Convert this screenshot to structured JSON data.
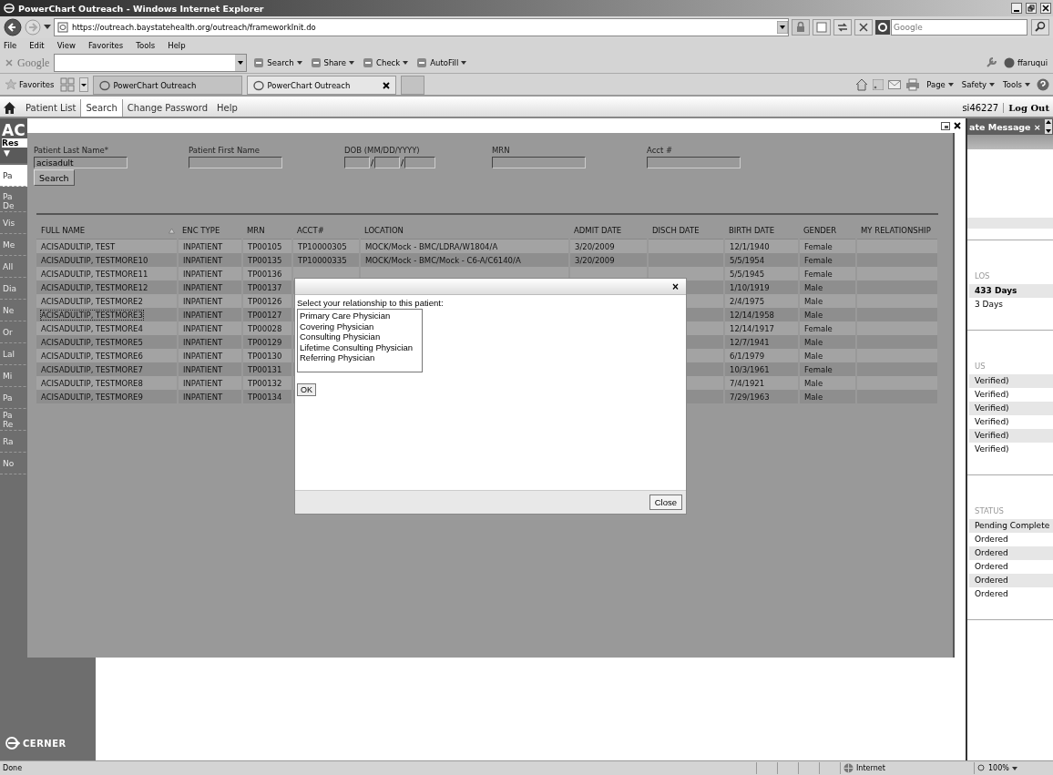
{
  "browser": {
    "title": "PowerChart Outreach - Windows Internet Explorer",
    "url": "https://outreach.baystatehealth.org/outreach/frameworkInit.do",
    "search_placeholder": "Google",
    "menu": [
      "File",
      "Edit",
      "View",
      "Favorites",
      "Tools",
      "Help"
    ],
    "google_toolbar": {
      "logo": "Google",
      "buttons": [
        "Search",
        "Share",
        "Check",
        "AutoFill"
      ],
      "user": "ffaruqui"
    },
    "favorites": "Favorites",
    "tabs": [
      {
        "label": "PowerChart Outreach",
        "selected": false
      },
      {
        "label": "PowerChart Outreach",
        "selected": true
      }
    ],
    "command_bar": [
      "Page",
      "Safety",
      "Tools"
    ],
    "status": "Done",
    "zone": "Internet",
    "zoom": "100%"
  },
  "app_nav": {
    "items": [
      {
        "label": "Patient List",
        "selected": false
      },
      {
        "label": "Search",
        "selected": true
      },
      {
        "label": "Change Password",
        "selected": false
      },
      {
        "label": "Help",
        "selected": false
      }
    ],
    "user": "si46227",
    "logout": "Log Out"
  },
  "sidebar": {
    "title": "AC",
    "subtitle": "Res",
    "toggle": "▼",
    "items": [
      {
        "label": "Pa",
        "selected": true
      },
      {
        "label": "Pa De",
        "selected": false
      },
      {
        "label": "Vis",
        "selected": false
      },
      {
        "label": "Me",
        "selected": false
      },
      {
        "label": "All",
        "selected": false
      },
      {
        "label": "Dia",
        "selected": false
      },
      {
        "label": "Ne",
        "selected": false
      },
      {
        "label": "Or",
        "selected": false
      },
      {
        "label": "Lal",
        "selected": false
      },
      {
        "label": "Mi",
        "selected": false
      },
      {
        "label": "Pa",
        "selected": false
      },
      {
        "label": "Pa Re",
        "selected": false
      },
      {
        "label": "Ra",
        "selected": false
      },
      {
        "label": "No",
        "selected": false
      }
    ],
    "logo": "CERNER"
  },
  "right_panel": {
    "tab": "ate Message ×",
    "sections": [
      {
        "header": "LOS",
        "rows": [
          {
            "text": "433 Days",
            "bold": true
          },
          {
            "text": "3 Days",
            "bold": false
          }
        ]
      },
      {
        "header": "US",
        "rows": [
          {
            "text": "Verified)",
            "bold": false
          },
          {
            "text": "Verified)",
            "bold": false
          },
          {
            "text": "Verified)",
            "bold": false
          },
          {
            "text": "Verified)",
            "bold": false
          },
          {
            "text": "Verified)",
            "bold": false
          },
          {
            "text": "Verified)",
            "bold": false
          }
        ]
      },
      {
        "header": "STATUS",
        "rows": [
          {
            "text": "Pending Complete",
            "bold": false
          },
          {
            "text": "Ordered",
            "bold": false
          },
          {
            "text": "Ordered",
            "bold": false
          },
          {
            "text": "Ordered",
            "bold": false
          },
          {
            "text": "Ordered",
            "bold": false
          },
          {
            "text": "Ordered",
            "bold": false
          }
        ]
      }
    ]
  },
  "search": {
    "fields": [
      {
        "kind": "text",
        "label": "Patient Last Name*",
        "value": "acisadult"
      },
      {
        "kind": "text",
        "label": "Patient First Name"
      },
      {
        "kind": "date",
        "label": "DOB (MM/DD/YYYY)",
        "separator": "/"
      },
      {
        "kind": "text",
        "label": "MRN"
      },
      {
        "kind": "text",
        "label": "Acct #"
      }
    ],
    "search_button": "Search",
    "table": {
      "columns": [
        {
          "label": "FULL NAME",
          "sorted": true
        },
        {
          "label": "ENC TYPE",
          "sorted": false
        },
        {
          "label": "MRN",
          "sorted": false
        },
        {
          "label": "ACCT#",
          "sorted": false
        },
        {
          "label": "LOCATION",
          "sorted": false
        },
        {
          "label": "ADMIT DATE",
          "sorted": false
        },
        {
          "label": "DISCH DATE",
          "sorted": false
        },
        {
          "label": "BIRTH DATE",
          "sorted": false
        },
        {
          "label": "GENDER",
          "sorted": false
        },
        {
          "label": "MY RELATIONSHIP",
          "sorted": false
        }
      ],
      "rows": [
        {
          "full_name": "ACISADULTIP, TEST",
          "enc_type": "INPATIENT",
          "mrn": "TP00105",
          "acct": "TP10000305",
          "location": "MOCK/Mock - BMC/LDRA/W1804/A",
          "admit_date": "3/20/2009",
          "birth_date": "12/1/1940",
          "gender": "Female",
          "focused": false
        },
        {
          "full_name": "ACISADULTIP, TESTMORE10",
          "enc_type": "INPATIENT",
          "mrn": "TP00135",
          "acct": "TP10000335",
          "location": "MOCK/Mock - BMC/Mock - C6-A/C6140/A",
          "admit_date": "3/20/2009",
          "birth_date": "5/5/1954",
          "gender": "Female",
          "focused": false
        },
        {
          "full_name": "ACISADULTIP, TESTMORE11",
          "enc_type": "INPATIENT",
          "mrn": "TP00136",
          "birth_date": "5/5/1945",
          "gender": "Female",
          "focused": false
        },
        {
          "full_name": "ACISADULTIP, TESTMORE12",
          "enc_type": "INPATIENT",
          "mrn": "TP00137",
          "birth_date": "1/10/1919",
          "gender": "Male",
          "focused": false
        },
        {
          "full_name": "ACISADULTIP, TESTMORE2",
          "enc_type": "INPATIENT",
          "mrn": "TP00126",
          "birth_date": "2/4/1975",
          "gender": "Male",
          "focused": false
        },
        {
          "full_name": "ACISADULTIP, TESTMORE3",
          "enc_type": "INPATIENT",
          "mrn": "TP00127",
          "birth_date": "12/14/1958",
          "gender": "Male",
          "focused": true
        },
        {
          "full_name": "ACISADULTIP, TESTMORE4",
          "enc_type": "INPATIENT",
          "mrn": "TP00028",
          "birth_date": "12/14/1917",
          "gender": "Female",
          "focused": false
        },
        {
          "full_name": "ACISADULTIP, TESTMORE5",
          "enc_type": "INPATIENT",
          "mrn": "TP00129",
          "birth_date": "12/7/1941",
          "gender": "Male",
          "focused": false
        },
        {
          "full_name": "ACISADULTIP, TESTMORE6",
          "enc_type": "INPATIENT",
          "mrn": "TP00130",
          "birth_date": "6/1/1979",
          "gender": "Male",
          "focused": false
        },
        {
          "full_name": "ACISADULTIP, TESTMORE7",
          "enc_type": "INPATIENT",
          "mrn": "TP00131",
          "birth_date": "10/3/1961",
          "gender": "Female",
          "focused": false
        },
        {
          "full_name": "ACISADULTIP, TESTMORE8",
          "enc_type": "INPATIENT",
          "mrn": "TP00132",
          "birth_date": "7/4/1921",
          "gender": "Male",
          "focused": false
        },
        {
          "full_name": "ACISADULTIP, TESTMORE9",
          "enc_type": "INPATIENT",
          "mrn": "TP00134",
          "birth_date": "7/29/1963",
          "gender": "Male",
          "focused": false
        }
      ]
    }
  },
  "dialog": {
    "close": "×",
    "prompt": "Select your relationship to this patient:",
    "options": [
      {
        "label": "Primary Care Physician",
        "selected": false
      },
      {
        "label": "Covering Physician",
        "selected": false
      },
      {
        "label": "Consulting Physician",
        "selected": false
      },
      {
        "label": "Lifetime Consulting Physician",
        "selected": false
      },
      {
        "label": "Referring Physician",
        "selected": false
      }
    ],
    "ok": "OK",
    "close_button": "Close"
  }
}
